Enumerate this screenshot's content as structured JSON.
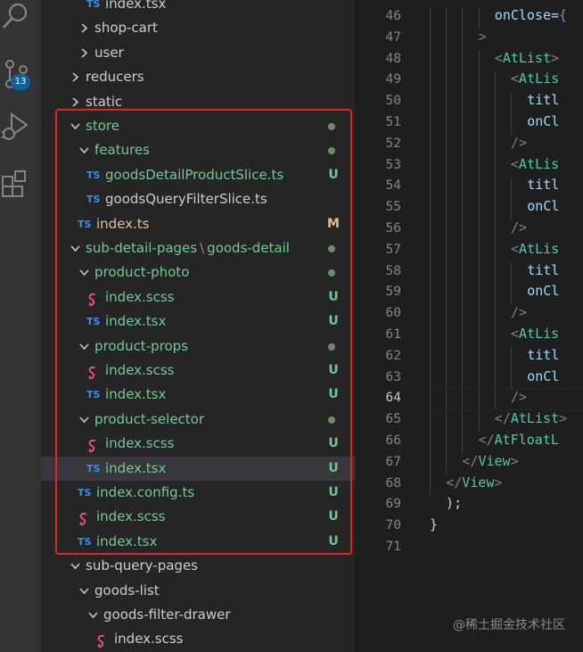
{
  "activity_bar": {
    "icons": [
      "search-icon",
      "source-control-icon",
      "run-debug-icon",
      "extensions-icon"
    ],
    "source_control_badge": "13"
  },
  "explorer": {
    "rows": [
      {
        "label": "index.tsx",
        "icon": "ts",
        "indent": 5,
        "status": ""
      },
      {
        "label": "shop-cart",
        "icon": "chevron-right",
        "indent": 4,
        "status": ""
      },
      {
        "label": "user",
        "icon": "chevron-right",
        "indent": 4,
        "status": ""
      },
      {
        "label": "reducers",
        "icon": "chevron-right",
        "indent": 3,
        "status": ""
      },
      {
        "label": "static",
        "icon": "chevron-right",
        "indent": 3,
        "status": ""
      },
      {
        "label": "store",
        "icon": "chevron-down",
        "indent": 3,
        "status": "dot",
        "color": "green"
      },
      {
        "label": "features",
        "icon": "chevron-down",
        "indent": 4,
        "status": "dot",
        "color": "green"
      },
      {
        "label": "goodsDetailProductSlice.ts",
        "icon": "ts",
        "indent": 5,
        "status": "U",
        "color": "green"
      },
      {
        "label": "goodsQueryFilterSlice.ts",
        "icon": "ts",
        "indent": 5,
        "status": ""
      },
      {
        "label": "index.ts",
        "icon": "ts",
        "indent": 4,
        "status": "M",
        "color": "mod"
      },
      {
        "label": "sub-detail-pages",
        "label2": "goods-detail",
        "icon": "chevron-down",
        "indent": 3,
        "status": "dot",
        "color": "green"
      },
      {
        "label": "product-photo",
        "icon": "chevron-down",
        "indent": 4,
        "status": "dot",
        "color": "green"
      },
      {
        "label": "index.scss",
        "icon": "scss",
        "indent": 5,
        "status": "U",
        "color": "green"
      },
      {
        "label": "index.tsx",
        "icon": "ts",
        "indent": 5,
        "status": "U",
        "color": "green"
      },
      {
        "label": "product-props",
        "icon": "chevron-down",
        "indent": 4,
        "status": "dot",
        "color": "green"
      },
      {
        "label": "index.scss",
        "icon": "scss",
        "indent": 5,
        "status": "U",
        "color": "green"
      },
      {
        "label": "index.tsx",
        "icon": "ts",
        "indent": 5,
        "status": "U",
        "color": "green"
      },
      {
        "label": "product-selector",
        "icon": "chevron-down",
        "indent": 4,
        "status": "dot",
        "color": "green"
      },
      {
        "label": "index.scss",
        "icon": "scss",
        "indent": 5,
        "status": "U",
        "color": "green"
      },
      {
        "label": "index.tsx",
        "icon": "ts",
        "indent": 5,
        "status": "U",
        "color": "green",
        "selected": true
      },
      {
        "label": "index.config.ts",
        "icon": "ts",
        "indent": 4,
        "status": "U",
        "color": "green"
      },
      {
        "label": "index.scss",
        "icon": "scss",
        "indent": 4,
        "status": "U",
        "color": "green"
      },
      {
        "label": "index.tsx",
        "icon": "ts",
        "indent": 4,
        "status": "U",
        "color": "green"
      },
      {
        "label": "sub-query-pages",
        "icon": "chevron-down",
        "indent": 3,
        "status": ""
      },
      {
        "label": "goods-list",
        "icon": "chevron-down",
        "indent": 4,
        "status": ""
      },
      {
        "label": "goods-filter-drawer",
        "icon": "chevron-down",
        "indent": 5,
        "status": ""
      },
      {
        "label": "index.scss",
        "icon": "scss",
        "indent": 6,
        "status": ""
      }
    ],
    "ts_icon_text": "TS",
    "path_separator": "\\"
  },
  "editor": {
    "current_line": "64",
    "lines": [
      {
        "n": "46",
        "indent": 4,
        "tokens": [
          {
            "t": "onClose",
            "c": "#9cdcfe"
          },
          {
            "t": "=",
            "c": "#d4d4d4"
          },
          {
            "t": "{",
            "c": "#569cd6"
          }
        ]
      },
      {
        "n": "47",
        "indent": 3,
        "tokens": [
          {
            "t": ">",
            "c": "#808080"
          }
        ]
      },
      {
        "n": "48",
        "indent": 4,
        "tokens": [
          {
            "t": "<",
            "c": "#808080"
          },
          {
            "t": "AtList",
            "c": "#4ec9b0"
          },
          {
            "t": ">",
            "c": "#808080"
          }
        ]
      },
      {
        "n": "49",
        "indent": 5,
        "tokens": [
          {
            "t": "<",
            "c": "#808080"
          },
          {
            "t": "AtLis",
            "c": "#4ec9b0"
          }
        ]
      },
      {
        "n": "50",
        "indent": 6,
        "tokens": [
          {
            "t": "titl",
            "c": "#9cdcfe"
          }
        ]
      },
      {
        "n": "51",
        "indent": 6,
        "tokens": [
          {
            "t": "onCl",
            "c": "#9cdcfe"
          }
        ]
      },
      {
        "n": "52",
        "indent": 5,
        "tokens": [
          {
            "t": "/>",
            "c": "#808080"
          }
        ]
      },
      {
        "n": "53",
        "indent": 5,
        "tokens": [
          {
            "t": "<",
            "c": "#808080"
          },
          {
            "t": "AtLis",
            "c": "#4ec9b0"
          }
        ]
      },
      {
        "n": "54",
        "indent": 6,
        "tokens": [
          {
            "t": "titl",
            "c": "#9cdcfe"
          }
        ]
      },
      {
        "n": "55",
        "indent": 6,
        "tokens": [
          {
            "t": "onCl",
            "c": "#9cdcfe"
          }
        ]
      },
      {
        "n": "56",
        "indent": 5,
        "tokens": [
          {
            "t": "/>",
            "c": "#808080"
          }
        ]
      },
      {
        "n": "57",
        "indent": 5,
        "tokens": [
          {
            "t": "<",
            "c": "#808080"
          },
          {
            "t": "AtLis",
            "c": "#4ec9b0"
          }
        ]
      },
      {
        "n": "58",
        "indent": 6,
        "tokens": [
          {
            "t": "titl",
            "c": "#9cdcfe"
          }
        ]
      },
      {
        "n": "59",
        "indent": 6,
        "tokens": [
          {
            "t": "onCl",
            "c": "#9cdcfe"
          }
        ]
      },
      {
        "n": "60",
        "indent": 5,
        "tokens": [
          {
            "t": "/>",
            "c": "#808080"
          }
        ]
      },
      {
        "n": "61",
        "indent": 5,
        "tokens": [
          {
            "t": "<",
            "c": "#808080"
          },
          {
            "t": "AtLis",
            "c": "#4ec9b0"
          }
        ]
      },
      {
        "n": "62",
        "indent": 6,
        "tokens": [
          {
            "t": "titl",
            "c": "#9cdcfe"
          }
        ]
      },
      {
        "n": "63",
        "indent": 6,
        "tokens": [
          {
            "t": "onCl",
            "c": "#9cdcfe"
          }
        ]
      },
      {
        "n": "64",
        "indent": 5,
        "tokens": [
          {
            "t": "/>",
            "c": "#808080"
          }
        ]
      },
      {
        "n": "65",
        "indent": 4,
        "tokens": [
          {
            "t": "</",
            "c": "#808080"
          },
          {
            "t": "AtList",
            "c": "#4ec9b0"
          },
          {
            "t": ">",
            "c": "#808080"
          }
        ]
      },
      {
        "n": "66",
        "indent": 3,
        "tokens": [
          {
            "t": "</",
            "c": "#808080"
          },
          {
            "t": "AtFloatL",
            "c": "#4ec9b0"
          }
        ]
      },
      {
        "n": "67",
        "indent": 2,
        "tokens": [
          {
            "t": "</",
            "c": "#808080"
          },
          {
            "t": "View",
            "c": "#4ec9b0"
          },
          {
            "t": ">",
            "c": "#808080"
          }
        ]
      },
      {
        "n": "68",
        "indent": 1,
        "tokens": [
          {
            "t": "</",
            "c": "#808080"
          },
          {
            "t": "View",
            "c": "#4ec9b0"
          },
          {
            "t": ">",
            "c": "#808080"
          }
        ]
      },
      {
        "n": "69",
        "indent": 0,
        "tokens": [
          {
            "t": "  );",
            "c": "#d4d4d4"
          }
        ]
      },
      {
        "n": "70",
        "indent": 0,
        "tokens": [
          {
            "t": "}",
            "c": "#d4d4d4"
          }
        ]
      },
      {
        "n": "71",
        "indent": 0,
        "tokens": []
      }
    ]
  },
  "watermark": "@稀土掘金技术社区",
  "colors": {
    "ts_icon": "#3b8eea",
    "scss_icon": "#f55385",
    "untracked": "#73c991",
    "modified": "#e2c08d",
    "highlight_box": "#e02424"
  }
}
